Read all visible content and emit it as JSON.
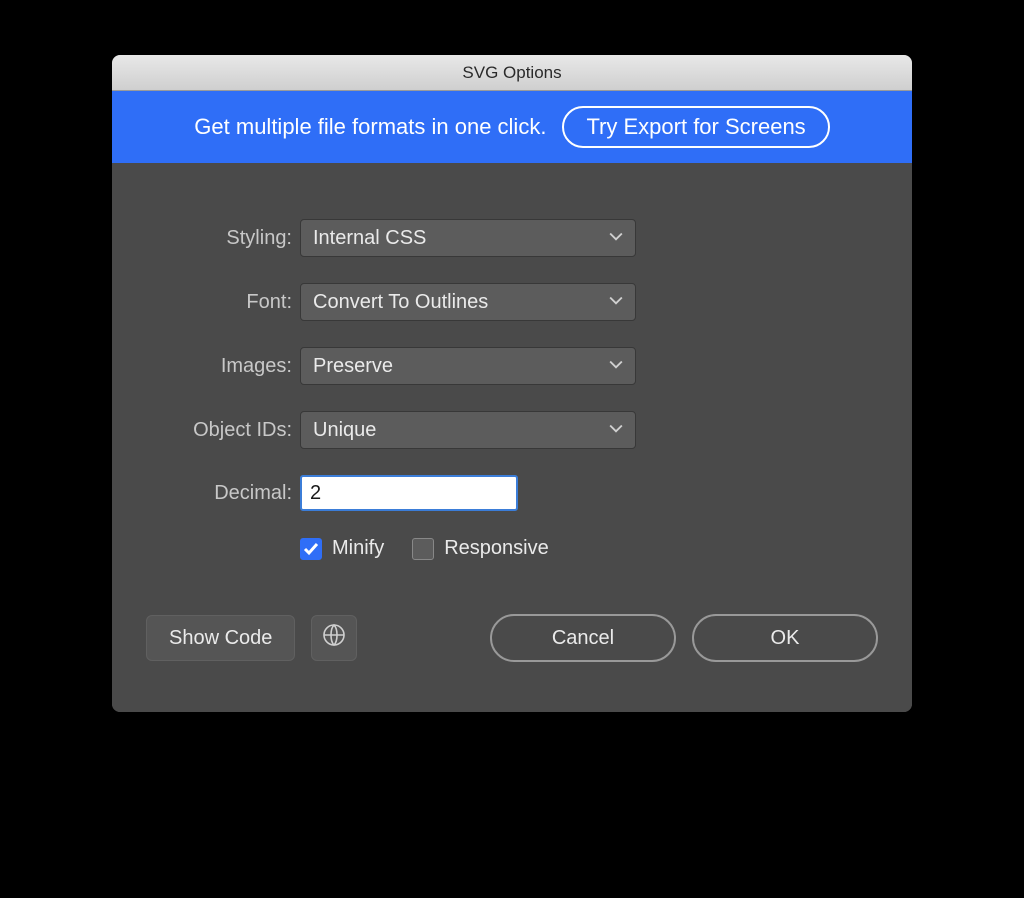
{
  "window": {
    "title": "SVG Options"
  },
  "promo": {
    "text": "Get multiple file formats in one click.",
    "button": "Try Export for Screens"
  },
  "form": {
    "styling": {
      "label": "Styling:",
      "value": "Internal CSS"
    },
    "font": {
      "label": "Font:",
      "value": "Convert To Outlines"
    },
    "images": {
      "label": "Images:",
      "value": "Preserve"
    },
    "object_ids": {
      "label": "Object IDs:",
      "value": "Unique"
    },
    "decimal": {
      "label": "Decimal:",
      "value": "2"
    },
    "minify": {
      "label": "Minify",
      "checked": true
    },
    "responsive": {
      "label": "Responsive",
      "checked": false
    }
  },
  "buttons": {
    "show_code": "Show Code",
    "cancel": "Cancel",
    "ok": "OK"
  }
}
